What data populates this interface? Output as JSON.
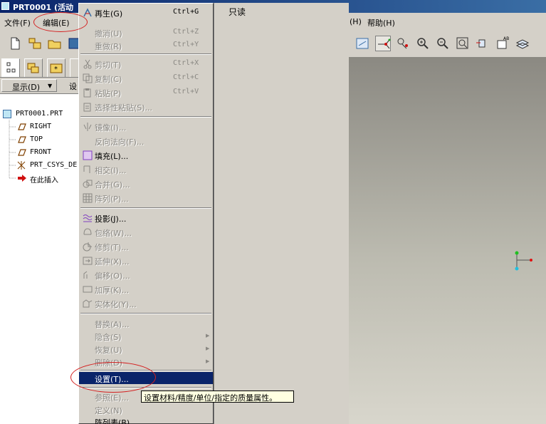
{
  "window": {
    "title": "PRT0001 (活动"
  },
  "menubar": {
    "items": [
      "文件(F)",
      "编辑(E)",
      "(H)",
      "帮助(H)"
    ]
  },
  "nav": {
    "show_label": "显示(D)",
    "settings_label": "设"
  },
  "tree": {
    "root": "PRT0001.PRT",
    "items": [
      "RIGHT",
      "TOP",
      "FRONT",
      "PRT_CSYS_DE",
      "在此插入"
    ]
  },
  "edit_menu": {
    "items": [
      {
        "label": "再生(G)",
        "shortcut": "Ctrl+G"
      },
      {
        "label": "撤消(U)",
        "shortcut": "Ctrl+Z"
      },
      {
        "label": "重做(R)",
        "shortcut": "Ctrl+Y"
      },
      {
        "label": "剪切(T)",
        "shortcut": "Ctrl+X"
      },
      {
        "label": "复制(C)",
        "shortcut": "Ctrl+C"
      },
      {
        "label": "粘贴(P)",
        "shortcut": "Ctrl+V"
      },
      {
        "label": "选择性粘贴(S)..."
      },
      {
        "label": "镜像(I)..."
      },
      {
        "label": "反向法向(F)..."
      },
      {
        "label": "填充(L)..."
      },
      {
        "label": "相交(I)..."
      },
      {
        "label": "合并(G)..."
      },
      {
        "label": "阵列(P)..."
      },
      {
        "label": "投影(J)..."
      },
      {
        "label": "包络(W)..."
      },
      {
        "label": "修剪(T)..."
      },
      {
        "label": "延伸(X)..."
      },
      {
        "label": "偏移(O)..."
      },
      {
        "label": "加厚(K)..."
      },
      {
        "label": "实体化(Y)..."
      },
      {
        "label": "替换(A)..."
      },
      {
        "label": "隐含(S)"
      },
      {
        "label": "恢复(U)"
      },
      {
        "label": "删除(D)"
      },
      {
        "label": "设置(T)..."
      },
      {
        "label": "参照(E)..."
      },
      {
        "label": "定义(N)"
      },
      {
        "label": "阵列表(B)"
      }
    ]
  },
  "submenu_panel": {
    "readonly": "只读"
  },
  "tooltip": "设置材料/精度/单位/指定的质量属性。",
  "icons": {
    "title": "part-icon",
    "graphics_toolbar": [
      "datum-display-icon",
      "axis-display-icon",
      "point-display-icon",
      "zoom-in-icon",
      "zoom-out-icon",
      "refit-icon",
      "orient-icon",
      "saved-views-icon",
      "layers-icon"
    ]
  },
  "colors": {
    "title_bar": "#0a246a",
    "selection": "#0a246a",
    "annotation_circle": "#d42020"
  }
}
